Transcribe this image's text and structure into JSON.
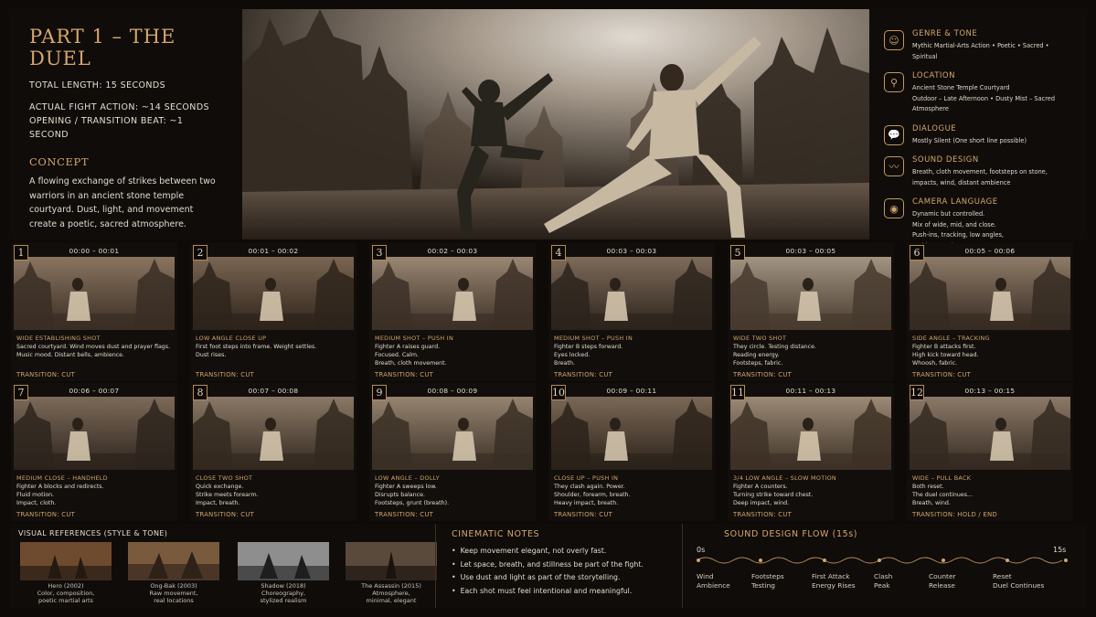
{
  "header": {
    "title": "PART 1 – THE DUEL",
    "total_length": "TOTAL LENGTH: 15 SECONDS",
    "fight_action": "ACTUAL FIGHT ACTION: ~14 SECONDS",
    "opening_beat": "OPENING / TRANSITION BEAT: ~1 SECOND",
    "concept_heading": "CONCEPT",
    "concept_text": "A flowing exchange of strikes between two warriors in an ancient stone temple courtyard. Dust, light, and movement create a poetic, sacred atmosphere."
  },
  "info": [
    {
      "icon": "theater-masks-icon",
      "heading": "GENRE & TONE",
      "text": "Mythic Martial-Arts Action  •  Poetic  •  Sacred  •  Spiritual"
    },
    {
      "icon": "location-pin-icon",
      "heading": "LOCATION",
      "text": "Ancient Stone Temple Courtyard\nOutdoor – Late Afternoon  •  Dusty Mist – Sacred Atmosphere"
    },
    {
      "icon": "speech-bubble-icon",
      "heading": "DIALOGUE",
      "text": "Mostly Silent (One short line possible)"
    },
    {
      "icon": "sound-wave-icon",
      "heading": "SOUND DESIGN",
      "text": "Breath, cloth movement, footsteps on stone,\nimpacts, wind, distant ambience"
    },
    {
      "icon": "camera-icon",
      "heading": "CAMERA LANGUAGE",
      "text": "Dynamic but controlled.\nMix of wide, mid, and close.\nPush-ins, tracking, low angles,\nand impact close-ups."
    }
  ],
  "shots": [
    {
      "num": "1",
      "time": "00:00 – 00:01",
      "type": "WIDE ESTABLISHING SHOT",
      "desc": "Sacred courtyard. Wind moves dust and prayer flags.\nMusic mood. Distant bells, ambience.",
      "transition": "TRANSITION: CUT"
    },
    {
      "num": "2",
      "time": "00:01 – 00:02",
      "type": "LOW ANGLE CLOSE UP",
      "desc": "First foot steps into frame. Weight settles.\nDust rises.",
      "transition": "TRANSITION: CUT"
    },
    {
      "num": "3",
      "time": "00:02 – 00:03",
      "type": "MEDIUM SHOT – PUSH IN",
      "desc": "Fighter A raises guard.\nFocused. Calm.\nBreath, cloth movement.",
      "transition": "TRANSITION: CUT"
    },
    {
      "num": "4",
      "time": "00:03 – 00:03",
      "type": "MEDIUM SHOT – PUSH IN",
      "desc": "Fighter B steps forward.\nEyes locked.\nBreath.",
      "transition": "TRANSITION: CUT"
    },
    {
      "num": "5",
      "time": "00:03 – 00:05",
      "type": "WIDE TWO SHOT",
      "desc": "They circle. Testing distance.\nReading energy.\nFootsteps, fabric.",
      "transition": "TRANSITION: CUT"
    },
    {
      "num": "6",
      "time": "00:05 – 00:06",
      "type": "SIDE ANGLE – TRACKING",
      "desc": "Fighter B attacks first.\nHigh kick toward head.\nWhoosh, fabric.",
      "transition": "TRANSITION: CUT"
    },
    {
      "num": "7",
      "time": "00:06 – 00:07",
      "type": "MEDIUM CLOSE – HANDHELD",
      "desc": "Fighter A blocks and redirects.\nFluid motion.\nImpact, cloth.",
      "transition": "TRANSITION: CUT"
    },
    {
      "num": "8",
      "time": "00:07 – 00:08",
      "type": "CLOSE TWO SHOT",
      "desc": "Quick exchange.\nStrike meets forearm.\nImpact, breath.",
      "transition": "TRANSITION: CUT"
    },
    {
      "num": "9",
      "time": "00:08 – 00:09",
      "type": "LOW ANGLE – DOLLY",
      "desc": "Fighter A sweeps low.\nDisrupts balance.\nFootsteps, grunt (breath).",
      "transition": "TRANSITION: CUT"
    },
    {
      "num": "10",
      "time": "00:09 – 00:11",
      "type": "CLOSE UP – PUSH IN",
      "desc": "They clash again. Power.\nShoulder, forearm, breath.\nHeavy impact, breath.",
      "transition": "TRANSITION: CUT"
    },
    {
      "num": "11",
      "time": "00:11 – 00:13",
      "type": "3/4 LOW ANGLE – SLOW MOTION",
      "desc": "Fighter A counters.\nTurning strike toward chest.\nDeep impact, wind.",
      "transition": "TRANSITION: CUT"
    },
    {
      "num": "12",
      "time": "00:13 – 00:15",
      "type": "WIDE – PULL BACK",
      "desc": "Both reset.\nThe duel continues...\nBreath, wind.",
      "transition": "TRANSITION: HOLD / END"
    }
  ],
  "references": {
    "heading": "VISUAL REFERENCES (STYLE & TONE)",
    "items": [
      {
        "title": "Hero (2002)",
        "note": "Color, composition,\npoetic martial arts"
      },
      {
        "title": "Ong-Bak (2003)",
        "note": "Raw movement,\nreal locations"
      },
      {
        "title": "Shadow (2018)",
        "note": "Choreography,\nstylized realism"
      },
      {
        "title": "The Assassin (2015)",
        "note": "Atmosphere,\nminimal, elegant"
      }
    ]
  },
  "notes": {
    "heading": "CINEMATIC NOTES",
    "items": [
      "Keep movement elegant, not overly fast.",
      "Let space, breath, and stillness be part of the fight.",
      "Use dust and light as part of the storytelling.",
      "Each shot must feel intentional and meaningful."
    ]
  },
  "flow": {
    "heading": "SOUND DESIGN FLOW (15s)",
    "start": "0s",
    "end": "15s",
    "stages": [
      {
        "a": "Wind",
        "b": "Ambience"
      },
      {
        "a": "Footsteps",
        "b": "Testing"
      },
      {
        "a": "First Attack",
        "b": "Energy Rises"
      },
      {
        "a": "Clash",
        "b": "Peak"
      },
      {
        "a": "Counter",
        "b": "Release"
      },
      {
        "a": "Reset",
        "b": "Duel Continues"
      }
    ]
  },
  "colors": {
    "accent": "#d2a56c",
    "background": "#0d0a08"
  }
}
